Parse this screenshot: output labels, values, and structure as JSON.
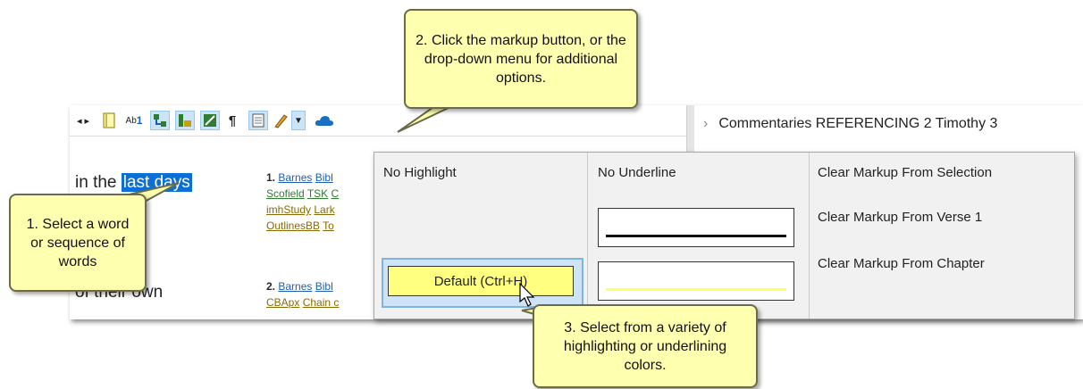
{
  "toolbar": {
    "icons": [
      "nav-arrows-icon",
      "notes-icon",
      "superscript-icon",
      "link-icon-1",
      "link-icon-2",
      "link-icon-3",
      "pilcrow-icon",
      "doc-icon",
      "pencil-icon",
      "dropdown-arrow-icon",
      "cloud-icon"
    ],
    "pilcrow": "¶",
    "superscript": "Ab"
  },
  "bible": {
    "pre_text": "in the ",
    "selected_text": "last days",
    "second_line_text": "of their own",
    "ref1_num": "1.",
    "ref1_line1": [
      "Barnes",
      "Bibl"
    ],
    "ref1_line2": [
      "Scofield",
      "TSK",
      "C"
    ],
    "ref1_line3": [
      "imhStudy",
      "Lark"
    ],
    "ref1_line4": [
      "OutlinesBB",
      "To"
    ],
    "ref2_num": "2.",
    "ref2_line1": [
      "Barnes",
      "Bibl"
    ],
    "ref2_line2": [
      "CBApx",
      "Chain c"
    ]
  },
  "commentary": {
    "header": "Commentaries REFERENCING 2 Timothy 3"
  },
  "menu": {
    "no_highlight": "No Highlight",
    "default_highlight": "Default (Ctrl+H)",
    "no_underline": "No Underline",
    "clear_selection": "Clear Markup From Selection",
    "clear_verse": "Clear Markup From Verse 1",
    "clear_chapter": "Clear Markup From Chapter",
    "colors": {
      "highlight_default": "#ffff80",
      "underline_black": "#111111",
      "underline_yellow": "#ffff66",
      "selection": "#0a6fd6"
    }
  },
  "callouts": {
    "c1": "1. Select a word or sequence of words",
    "c2": "2. Click the markup button, or the drop-down menu for additional options.",
    "c3": "3. Select from a variety of highlighting or underlining colors."
  }
}
